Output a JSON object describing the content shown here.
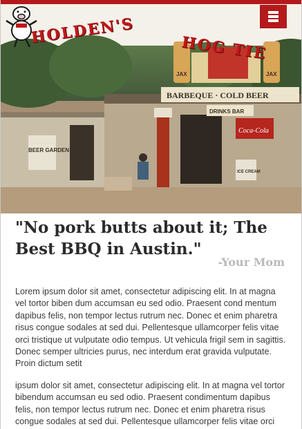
{
  "header": {
    "menu_icon": "hamburger-menu-icon",
    "logo": {
      "left_text": "HOLDEN'S",
      "right_text": "HOG TIE",
      "mascot_icon": "pig-mascot-icon"
    }
  },
  "hero": {
    "signs": {
      "roof": "BARBEQUE · COLD BEER",
      "drinks": "DRINKS BAR",
      "cola": "Coca-Cola",
      "jax_left": "JAX",
      "jax_right": "JAX",
      "garden": "BEER GARDEN",
      "ice_cream": "ICE CREAM"
    }
  },
  "quote": {
    "text": "\"No pork butts about it; The Best BBQ in Austin.\"",
    "attribution": "-Your Mom"
  },
  "content": {
    "paragraphs": [
      "Lorem ipsum dolor sit amet, consectetur adipiscing elit. In at magna vel tortor biben dum accumsan eu sed odio. Praesent cond mentum dapibus felis, non tempor lectus rutrum nec. Donec et enim pharetra risus congue sodales at sed dui. Pellentesque ullamcorper felis vitae orci tristique ut vulputate odio tempus. Ut vehicula frigil sem in sagittis. Donec semper ultricies purus, nec interdum erat gravida vulputate. Proin dictum setit",
      "ipsum dolor sit amet, consectetur adipiscing elit. In at magna vel tortor bibendum accumsan eu sed odio. Praesent condimentum dapibus felis, non tempor lectus rutrum nec. Donec et enim pharetra risus congue sodales at sed dui. Pellentesque ullamcorper felis vitae orci tristique ut vulputate odio tempus. Ut vehicula fringilla"
    ]
  },
  "colors": {
    "brand_red": "#b4191c",
    "quote_text": "#2b2b2b",
    "attribution": "#b9b9b9"
  }
}
